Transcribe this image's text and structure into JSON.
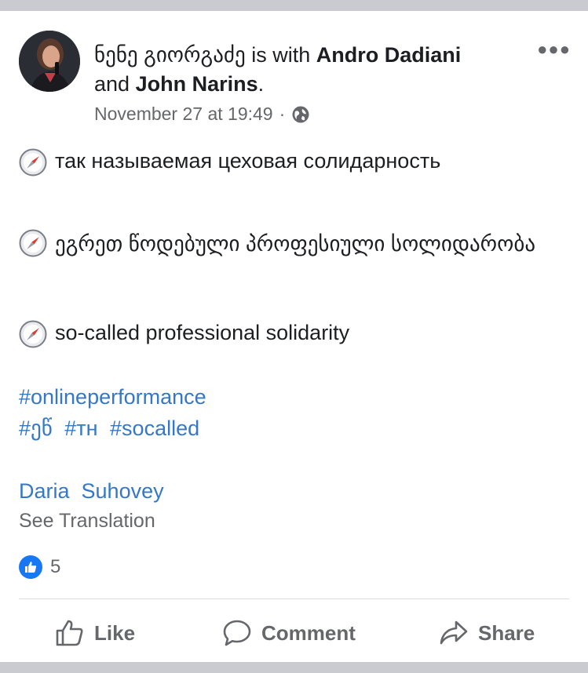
{
  "post": {
    "author": "ნენე გიორგაძე",
    "with_text": "is with",
    "tagged_1": "Andro Dadiani",
    "and_text": "and",
    "tagged_2": "John Narins",
    "period": ".",
    "timestamp": "November 27 at 19:49",
    "separator": "·",
    "privacy_icon": "globe-icon",
    "lines": [
      "так называемая цеховая солидарность",
      "ეგრეთ წოდებული პროფესიული სოლიდარობა",
      "so-called professional solidarity"
    ],
    "line_icon": "compass-icon",
    "hashtags_row1": "#onlineperformance",
    "hashtags_row2": [
      "#ეწ",
      "#тн",
      "#socalled"
    ],
    "mention": "Daria  Suhovey",
    "see_translation": "See Translation",
    "like_count": "5"
  },
  "actions": {
    "like_label": "Like",
    "comment_label": "Comment",
    "share_label": "Share"
  },
  "colors": {
    "link": "#3478c7",
    "meta": "#65676b",
    "like_blue": "#1877f2"
  }
}
